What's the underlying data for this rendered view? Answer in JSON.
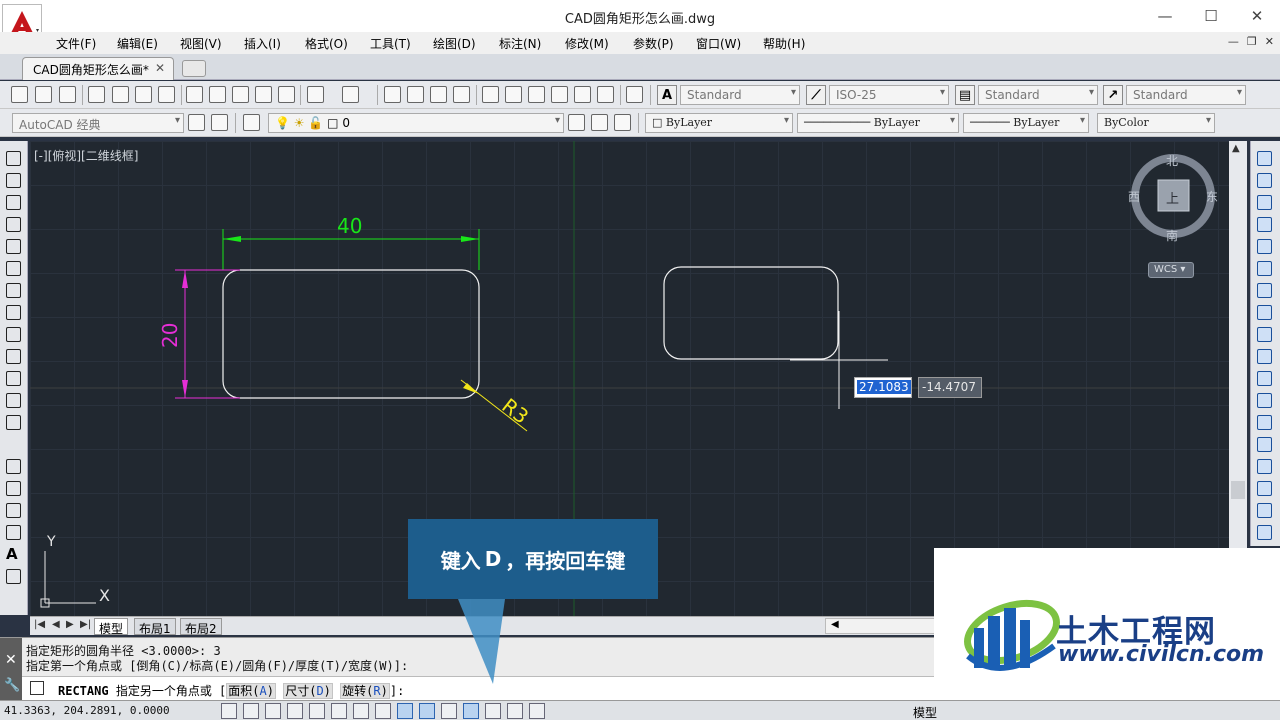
{
  "window": {
    "title": "CAD圆角矩形怎么画.dwg",
    "minimize": "—",
    "maximize": "☐",
    "close": "✕"
  },
  "menu": [
    "文件(F)",
    "编辑(E)",
    "视图(V)",
    "插入(I)",
    "格式(O)",
    "工具(T)",
    "绘图(D)",
    "标注(N)",
    "修改(M)",
    "参数(P)",
    "窗口(W)",
    "帮助(H)"
  ],
  "doc_tab": {
    "label": "CAD圆角矩形怎么画*",
    "close": "✕"
  },
  "toolbar1": {
    "text_style": "Standard",
    "dim_style": "ISO-25",
    "table_style": "Standard",
    "multileader_style": "Standard"
  },
  "toolbar2": {
    "workspace": "AutoCAD 经典",
    "layer": "0",
    "color": "ByLayer",
    "linetype": "ByLayer",
    "lineweight": "ByLayer",
    "plot_style": "ByColor"
  },
  "viewport": {
    "label": "[-][俯视][二维线框]",
    "dims": {
      "width_label": "40",
      "height_label": "20",
      "radius_label": "R3"
    },
    "ucs": {
      "y": "Y",
      "x": "X"
    }
  },
  "viewcube": {
    "north": "北",
    "south": "南",
    "west": "西",
    "east": "东",
    "face": "上",
    "wcs": "WCS"
  },
  "dynamic_input": {
    "x": "27.1083",
    "y": "-14.4707"
  },
  "layout_tabs": {
    "model": "模型",
    "layout1": "布局1",
    "layout2": "布局2"
  },
  "command": {
    "history1": "指定矩形的圆角半径 <3.0000>: 3",
    "history2": "指定第一个角点或 [倒角(C)/标高(E)/圆角(F)/厚度(T)/宽度(W)]:",
    "name": "RECTANG",
    "prompt": "指定另一个角点或 [",
    "opt1": "面积(",
    "opt1_key": "A",
    "opt2": "尺寸(",
    "opt2_key": "D",
    "opt3": "旋转(",
    "opt3_key": "R",
    "suffix": "]:"
  },
  "status": {
    "coords": "41.3363,  204.2891, 0.0000",
    "model": "模型"
  },
  "callout": {
    "prefix": "键入 ",
    "key": "D",
    "suffix": "，再按回车键"
  },
  "watermark": {
    "name": "土木工程网",
    "url": "www.civilcn.com"
  },
  "colors": {
    "dimension_green": "#19e619",
    "dimension_magenta": "#e62ed6",
    "radius_yellow": "#f2e61a",
    "callout_bg": "#1d5d8c"
  }
}
